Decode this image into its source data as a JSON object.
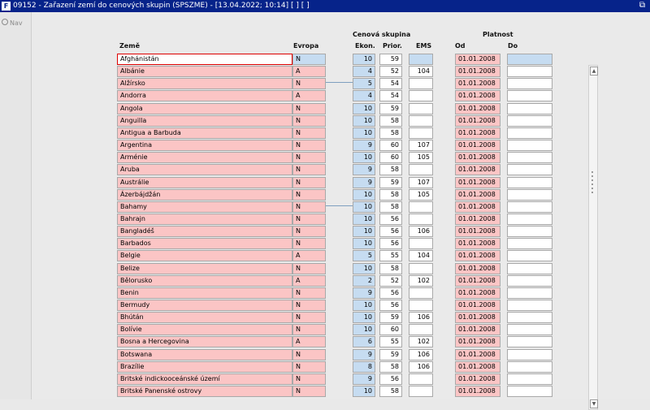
{
  "window": {
    "title": "09152 - Zařazení zemí do cenových skupin (SPSZME) - [13.04.2022; 10:14]  [ ] [ ]",
    "app_icon": "F",
    "restore_glyph": "⧉"
  },
  "nav": {
    "label": "Nav"
  },
  "headers": {
    "zeme": "Země",
    "evropa": "Evropa",
    "cenova_skupina": "Cenová skupina",
    "ekon": "Ekon.",
    "prior": "Prior.",
    "ems": "EMS",
    "platnost": "Platnost",
    "od": "Od",
    "do": "Do"
  },
  "rows": [
    {
      "zeme": "Afghánistán",
      "evropa": "N",
      "ekon": "10",
      "prior": "59",
      "ems": "",
      "od": "01.01.2008",
      "do": ""
    },
    {
      "zeme": "Albánie",
      "evropa": "A",
      "ekon": "4",
      "prior": "52",
      "ems": "104",
      "od": "01.01.2008",
      "do": ""
    },
    {
      "zeme": "Alžírsko",
      "evropa": "N",
      "ekon": "5",
      "prior": "54",
      "ems": "",
      "od": "01.01.2008",
      "do": ""
    },
    {
      "zeme": "Andorra",
      "evropa": "A",
      "ekon": "4",
      "prior": "54",
      "ems": "",
      "od": "01.01.2008",
      "do": ""
    },
    {
      "zeme": "Angola",
      "evropa": "N",
      "ekon": "10",
      "prior": "59",
      "ems": "",
      "od": "01.01.2008",
      "do": ""
    },
    {
      "zeme": "Anguilla",
      "evropa": "N",
      "ekon": "10",
      "prior": "58",
      "ems": "",
      "od": "01.01.2008",
      "do": ""
    },
    {
      "zeme": "Antigua a Barbuda",
      "evropa": "N",
      "ekon": "10",
      "prior": "58",
      "ems": "",
      "od": "01.01.2008",
      "do": ""
    },
    {
      "zeme": "Argentina",
      "evropa": "N",
      "ekon": "9",
      "prior": "60",
      "ems": "107",
      "od": "01.01.2008",
      "do": ""
    },
    {
      "zeme": "Arménie",
      "evropa": "N",
      "ekon": "10",
      "prior": "60",
      "ems": "105",
      "od": "01.01.2008",
      "do": ""
    },
    {
      "zeme": "Aruba",
      "evropa": "N",
      "ekon": "9",
      "prior": "58",
      "ems": "",
      "od": "01.01.2008",
      "do": ""
    },
    {
      "zeme": "Austrálie",
      "evropa": "N",
      "ekon": "9",
      "prior": "59",
      "ems": "107",
      "od": "01.01.2008",
      "do": ""
    },
    {
      "zeme": "Ázerbájdžán",
      "evropa": "N",
      "ekon": "10",
      "prior": "58",
      "ems": "105",
      "od": "01.01.2008",
      "do": ""
    },
    {
      "zeme": "Bahamy",
      "evropa": "N",
      "ekon": "10",
      "prior": "58",
      "ems": "",
      "od": "01.01.2008",
      "do": ""
    },
    {
      "zeme": "Bahrajn",
      "evropa": "N",
      "ekon": "10",
      "prior": "56",
      "ems": "",
      "od": "01.01.2008",
      "do": ""
    },
    {
      "zeme": "Bangladéš",
      "evropa": "N",
      "ekon": "10",
      "prior": "56",
      "ems": "106",
      "od": "01.01.2008",
      "do": ""
    },
    {
      "zeme": "Barbados",
      "evropa": "N",
      "ekon": "10",
      "prior": "56",
      "ems": "",
      "od": "01.01.2008",
      "do": ""
    },
    {
      "zeme": "Belgie",
      "evropa": "A",
      "ekon": "5",
      "prior": "55",
      "ems": "104",
      "od": "01.01.2008",
      "do": ""
    },
    {
      "zeme": "Belize",
      "evropa": "N",
      "ekon": "10",
      "prior": "58",
      "ems": "",
      "od": "01.01.2008",
      "do": ""
    },
    {
      "zeme": "Bělorusko",
      "evropa": "A",
      "ekon": "2",
      "prior": "52",
      "ems": "102",
      "od": "01.01.2008",
      "do": ""
    },
    {
      "zeme": "Benin",
      "evropa": "N",
      "ekon": "9",
      "prior": "56",
      "ems": "",
      "od": "01.01.2008",
      "do": ""
    },
    {
      "zeme": "Bermudy",
      "evropa": "N",
      "ekon": "10",
      "prior": "56",
      "ems": "",
      "od": "01.01.2008",
      "do": ""
    },
    {
      "zeme": "Bhútán",
      "evropa": "N",
      "ekon": "10",
      "prior": "59",
      "ems": "106",
      "od": "01.01.2008",
      "do": ""
    },
    {
      "zeme": "Bolívie",
      "evropa": "N",
      "ekon": "10",
      "prior": "60",
      "ems": "",
      "od": "01.01.2008",
      "do": ""
    },
    {
      "zeme": "Bosna a Hercegovina",
      "evropa": "A",
      "ekon": "6",
      "prior": "55",
      "ems": "102",
      "od": "01.01.2008",
      "do": ""
    },
    {
      "zeme": "Botswana",
      "evropa": "N",
      "ekon": "9",
      "prior": "59",
      "ems": "106",
      "od": "01.01.2008",
      "do": ""
    },
    {
      "zeme": "Brazílie",
      "evropa": "N",
      "ekon": "8",
      "prior": "58",
      "ems": "106",
      "od": "01.01.2008",
      "do": ""
    },
    {
      "zeme": "Britské indickooceánské území",
      "evropa": "N",
      "ekon": "9",
      "prior": "56",
      "ems": "",
      "od": "01.01.2008",
      "do": ""
    },
    {
      "zeme": "Britské Panenské ostrovy",
      "evropa": "N",
      "ekon": "10",
      "prior": "58",
      "ems": "",
      "od": "01.01.2008",
      "do": ""
    }
  ],
  "colors": {
    "title_bar": "#06238a",
    "required_field": "#fbc5c5",
    "current_row": "#c6dcf1",
    "focus_border": "#dd0000"
  }
}
